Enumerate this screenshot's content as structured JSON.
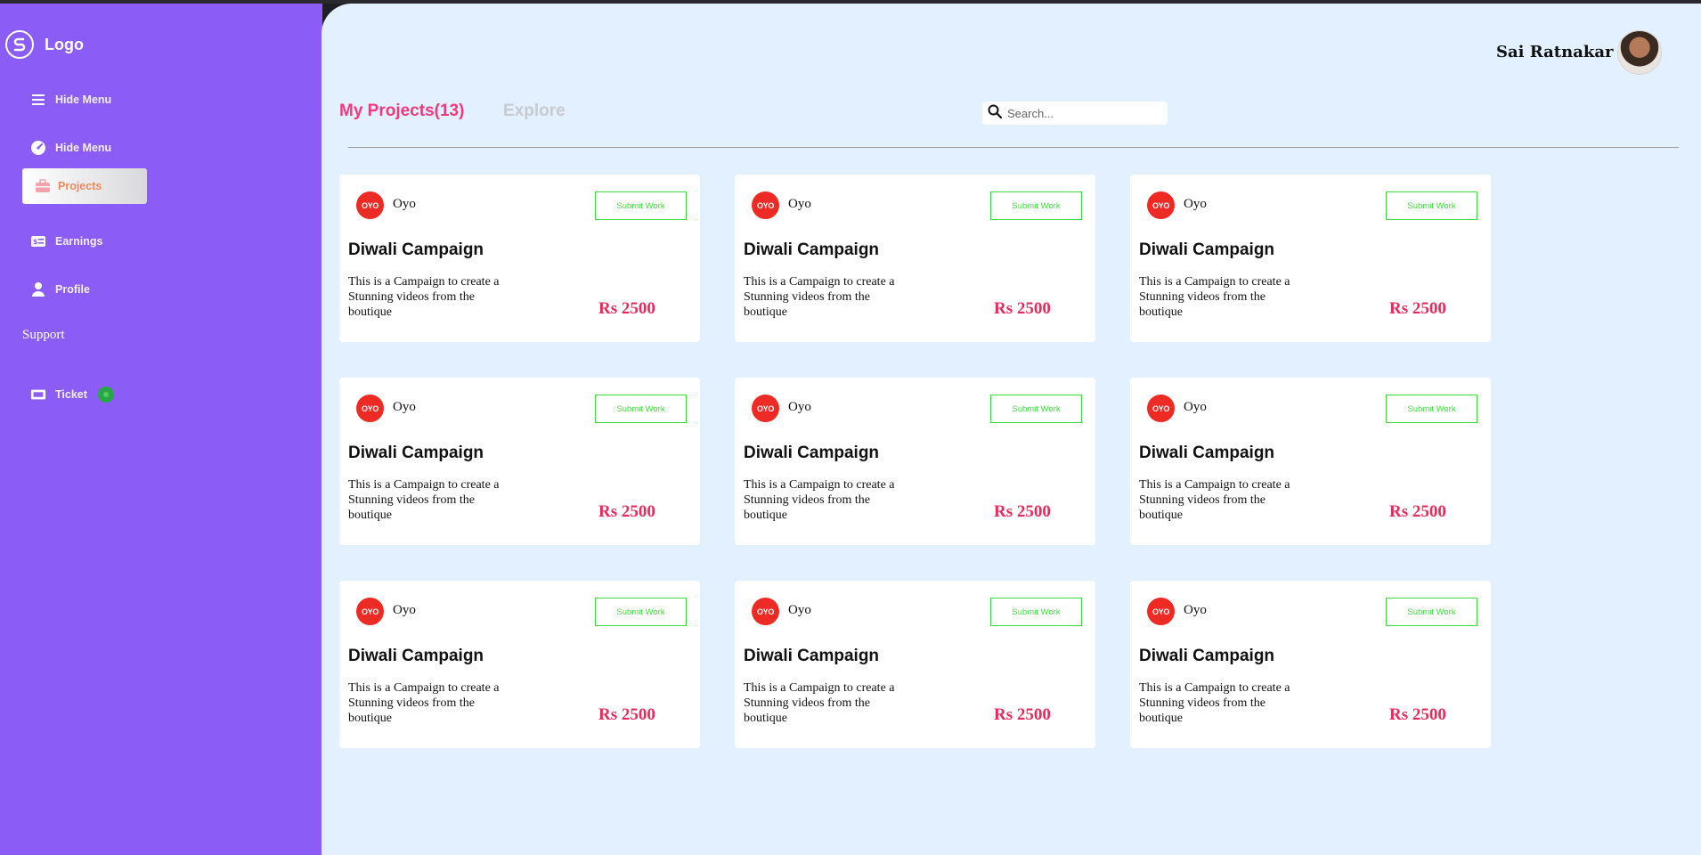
{
  "brand": {
    "logo_text": "Logo"
  },
  "sidebar": {
    "items": [
      {
        "label": "Hide Menu",
        "icon": "menu-icon"
      },
      {
        "label": "Hide Menu",
        "icon": "dashboard-icon"
      },
      {
        "label": "Projects",
        "icon": "briefcase-icon",
        "active": true
      },
      {
        "label": "Earnings",
        "icon": "money-icon"
      },
      {
        "label": "Profile",
        "icon": "user-icon"
      }
    ],
    "support_label": "Support",
    "ticket_label": "Ticket"
  },
  "header": {
    "user_name": "Sai Ratnakar"
  },
  "tabs": {
    "my_projects": "My Projects(13)",
    "explore": "Explore"
  },
  "search": {
    "placeholder": "Search..."
  },
  "cards": [
    {
      "brand": "Oyo",
      "brand_logo": "OYO",
      "button": "Submit Work",
      "title": "Diwali Campaign",
      "description": "This is a Campaign to create a Stunning videos from the boutique",
      "price": "Rs 2500"
    },
    {
      "brand": "Oyo",
      "brand_logo": "OYO",
      "button": "Submit Work",
      "title": "Diwali Campaign",
      "description": "This is a Campaign to create a Stunning videos from the boutique",
      "price": "Rs 2500"
    },
    {
      "brand": "Oyo",
      "brand_logo": "OYO",
      "button": "Submit Work",
      "title": "Diwali Campaign",
      "description": "This is a Campaign to create a Stunning videos from the boutique",
      "price": "Rs 2500"
    },
    {
      "brand": "Oyo",
      "brand_logo": "OYO",
      "button": "Submit Work",
      "title": "Diwali Campaign",
      "description": "This is a Campaign to create a Stunning videos from the boutique",
      "price": "Rs 2500"
    },
    {
      "brand": "Oyo",
      "brand_logo": "OYO",
      "button": "Submit Work",
      "title": "Diwali Campaign",
      "description": "This is a Campaign to create a Stunning videos from the boutique",
      "price": "Rs 2500"
    },
    {
      "brand": "Oyo",
      "brand_logo": "OYO",
      "button": "Submit Work",
      "title": "Diwali Campaign",
      "description": "This is a Campaign to create a Stunning videos from the boutique",
      "price": "Rs 2500"
    },
    {
      "brand": "Oyo",
      "brand_logo": "OYO",
      "button": "Submit Work",
      "title": "Diwali Campaign",
      "description": "This is a Campaign to create a Stunning videos from the boutique",
      "price": "Rs 2500"
    },
    {
      "brand": "Oyo",
      "brand_logo": "OYO",
      "button": "Submit Work",
      "title": "Diwali Campaign",
      "description": "This is a Campaign to create a Stunning videos from the boutique",
      "price": "Rs 2500"
    },
    {
      "brand": "Oyo",
      "brand_logo": "OYO",
      "button": "Submit Work",
      "title": "Diwali Campaign",
      "description": "This is a Campaign to create a Stunning videos from the boutique",
      "price": "Rs 2500"
    }
  ],
  "colors": {
    "sidebar_bg": "#8b5cf6",
    "main_bg": "#e3f0ff",
    "accent_pink": "#f0397a",
    "price_red": "#ea2a5d",
    "submit_green": "#3ddc3d",
    "oyo_red": "#ee2a24",
    "active_nav_text": "#f08a5d"
  }
}
